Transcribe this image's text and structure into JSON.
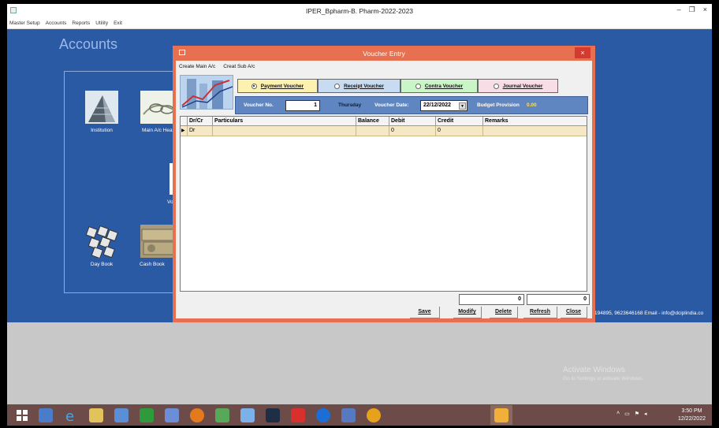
{
  "window": {
    "title": "IPER_Bpharm-B. Pharm-2022-2023",
    "controls": [
      "–",
      "❐",
      "×"
    ]
  },
  "menubar": [
    "Master Setup",
    "Accounts",
    "Reports",
    "Utility",
    "Exit"
  ],
  "accounts_title": "Accounts",
  "tiles": {
    "institution": "Institution",
    "main_ac": "Main A/c Hea",
    "voucher": "Vo",
    "day_book": "Day Book",
    "cash_book": "Cash Book"
  },
  "contact_text": "194895, 9623646168 Email - info@dciplindia.co",
  "activate": {
    "line1": "Activate Windows",
    "line2": "Go to Settings to activate Windows."
  },
  "dialog": {
    "title": "Voucher Entry",
    "close": "×",
    "menu": [
      "Create Main A/c",
      "Creat Sub A/c"
    ],
    "voucher_types": [
      {
        "label": "Payment Voucher",
        "selected": true,
        "color": "#fdf1b0"
      },
      {
        "label": "Receipt Voucher",
        "selected": false,
        "color": "#c7dcf1"
      },
      {
        "label": "Contra Voucher",
        "selected": false,
        "color": "#caf5c6"
      },
      {
        "label": "Journal Voucher",
        "selected": false,
        "color": "#f9dde6"
      }
    ],
    "voucher_no_label": "Voucher No.",
    "voucher_no": "1",
    "day": "Thursday",
    "voucher_date_label": "Voucher Date:",
    "voucher_date": "22/12/2022",
    "budget_label": "Budget Provision",
    "budget_value": "0.00",
    "columns": [
      "Dr/Cr",
      "Particulars",
      "Balance",
      "Debit",
      "Credit",
      "Remarks"
    ],
    "row": {
      "marker": "▶",
      "drcr": "Dr",
      "particulars": "",
      "balance": "",
      "debit": "0",
      "credit": "0",
      "remarks": ""
    },
    "total_debit": "0",
    "total_credit": "0",
    "buttons": {
      "save": "Save",
      "modify": "Modify",
      "delete": "Delete",
      "refresh": "Refresh",
      "close": "Close"
    }
  },
  "clock": {
    "time": "3:50 PM",
    "date": "12/22/2022"
  }
}
